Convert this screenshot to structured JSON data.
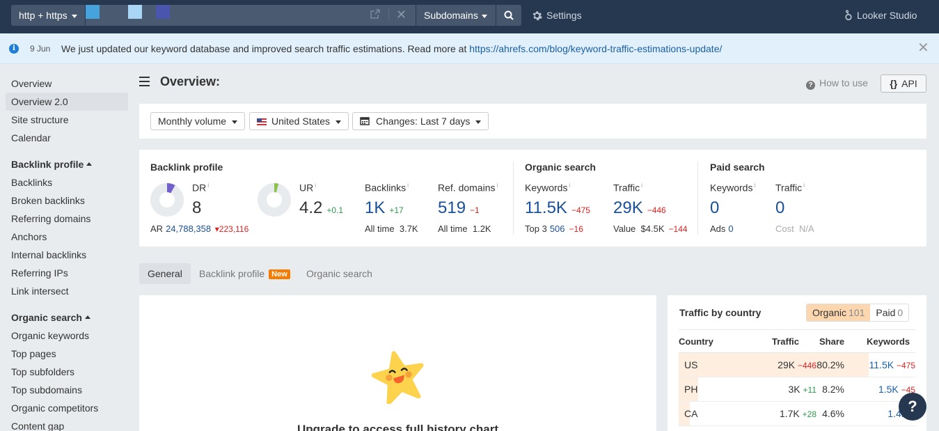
{
  "topbar": {
    "protocol": "http + https",
    "url_color_swatches": [
      "#47a3db",
      "#a9d6f4",
      "#4a55ad"
    ],
    "mode": "Subdomains",
    "settings_label": "Settings",
    "looker_label": "Looker Studio"
  },
  "banner": {
    "date": "9 Jun",
    "text": "We just updated our keyword database and improved search traffic estimations. Read more at ",
    "link": "https://ahrefs.com/blog/keyword-traffic-estimations-update/"
  },
  "sidebar": {
    "items_top": [
      "Overview",
      "Overview 2.0",
      "Site structure",
      "Calendar"
    ],
    "active": "Overview 2.0",
    "backlink_heading": "Backlink profile",
    "backlink_items": [
      "Backlinks",
      "Broken backlinks",
      "Referring domains",
      "Anchors",
      "Internal backlinks",
      "Referring IPs",
      "Link intersect"
    ],
    "organic_heading": "Organic search",
    "organic_items": [
      "Organic keywords",
      "Top pages",
      "Top subfolders",
      "Top subdomains",
      "Organic competitors",
      "Content gap"
    ]
  },
  "header": {
    "title": "Overview:",
    "how_to_use": "How to use",
    "api": "API"
  },
  "filters": {
    "volume": "Monthly volume",
    "country": "United States",
    "changes": "Changes: Last 7 days"
  },
  "metrics": {
    "backlink_profile": {
      "title": "Backlink profile",
      "dr": {
        "label": "DR",
        "value": "8",
        "gauge_fraction": 0.08,
        "color": "#7460c9"
      },
      "ar": {
        "label": "AR",
        "value": "24,788,358",
        "delta": "223,116"
      },
      "ur": {
        "label": "UR",
        "value": "4.2",
        "delta": "+0.1",
        "gauge_fraction": 0.042,
        "color": "#8bc34a"
      },
      "backlinks": {
        "label": "Backlinks",
        "value": "1K",
        "delta": "+17",
        "sub_label": "All time",
        "sub_value": "3.7K"
      },
      "ref_domains": {
        "label": "Ref. domains",
        "value": "519",
        "delta": "−1",
        "sub_label": "All time",
        "sub_value": "1.2K"
      }
    },
    "organic_search": {
      "title": "Organic search",
      "keywords": {
        "label": "Keywords",
        "value": "11.5K",
        "delta": "−475",
        "sub_label": "Top 3",
        "sub_value": "506",
        "sub_delta": "−16"
      },
      "traffic": {
        "label": "Traffic",
        "value": "29K",
        "delta": "−446",
        "sub_label": "Value",
        "sub_value": "$4.5K",
        "sub_delta": "−144"
      }
    },
    "paid_search": {
      "title": "Paid search",
      "keywords": {
        "label": "Keywords",
        "value": "0",
        "sub_label": "Ads",
        "sub_value": "0"
      },
      "traffic": {
        "label": "Traffic",
        "value": "0",
        "sub_label": "Cost",
        "sub_value": "N/A"
      }
    }
  },
  "tabs": [
    {
      "label": "General",
      "active": true
    },
    {
      "label": "Backlink profile",
      "badge": "New"
    },
    {
      "label": "Organic search"
    }
  ],
  "history": {
    "upgrade_text": "Upgrade to access full history chart"
  },
  "country_traffic": {
    "title": "Traffic by country",
    "toggle": [
      {
        "label": "Organic",
        "count": "101",
        "active": true
      },
      {
        "label": "Paid",
        "count": "0"
      }
    ],
    "columns": [
      "Country",
      "Traffic",
      "Share",
      "Keywords"
    ],
    "rows": [
      {
        "country": "US",
        "traffic": "29K",
        "traffic_delta": "−446",
        "share": "80.2%",
        "share_fraction": 0.802,
        "keywords": "11.5K",
        "keywords_delta": "−475"
      },
      {
        "country": "PH",
        "traffic": "3K",
        "traffic_delta": "+11",
        "share": "8.2%",
        "share_fraction": 0.082,
        "keywords": "1.5K",
        "keywords_delta": "−45"
      },
      {
        "country": "CA",
        "traffic": "1.7K",
        "traffic_delta": "+28",
        "share": "4.6%",
        "share_fraction": 0.046,
        "keywords": "1.4K",
        "keywords_delta": "−"
      }
    ]
  },
  "help_fab": "?"
}
